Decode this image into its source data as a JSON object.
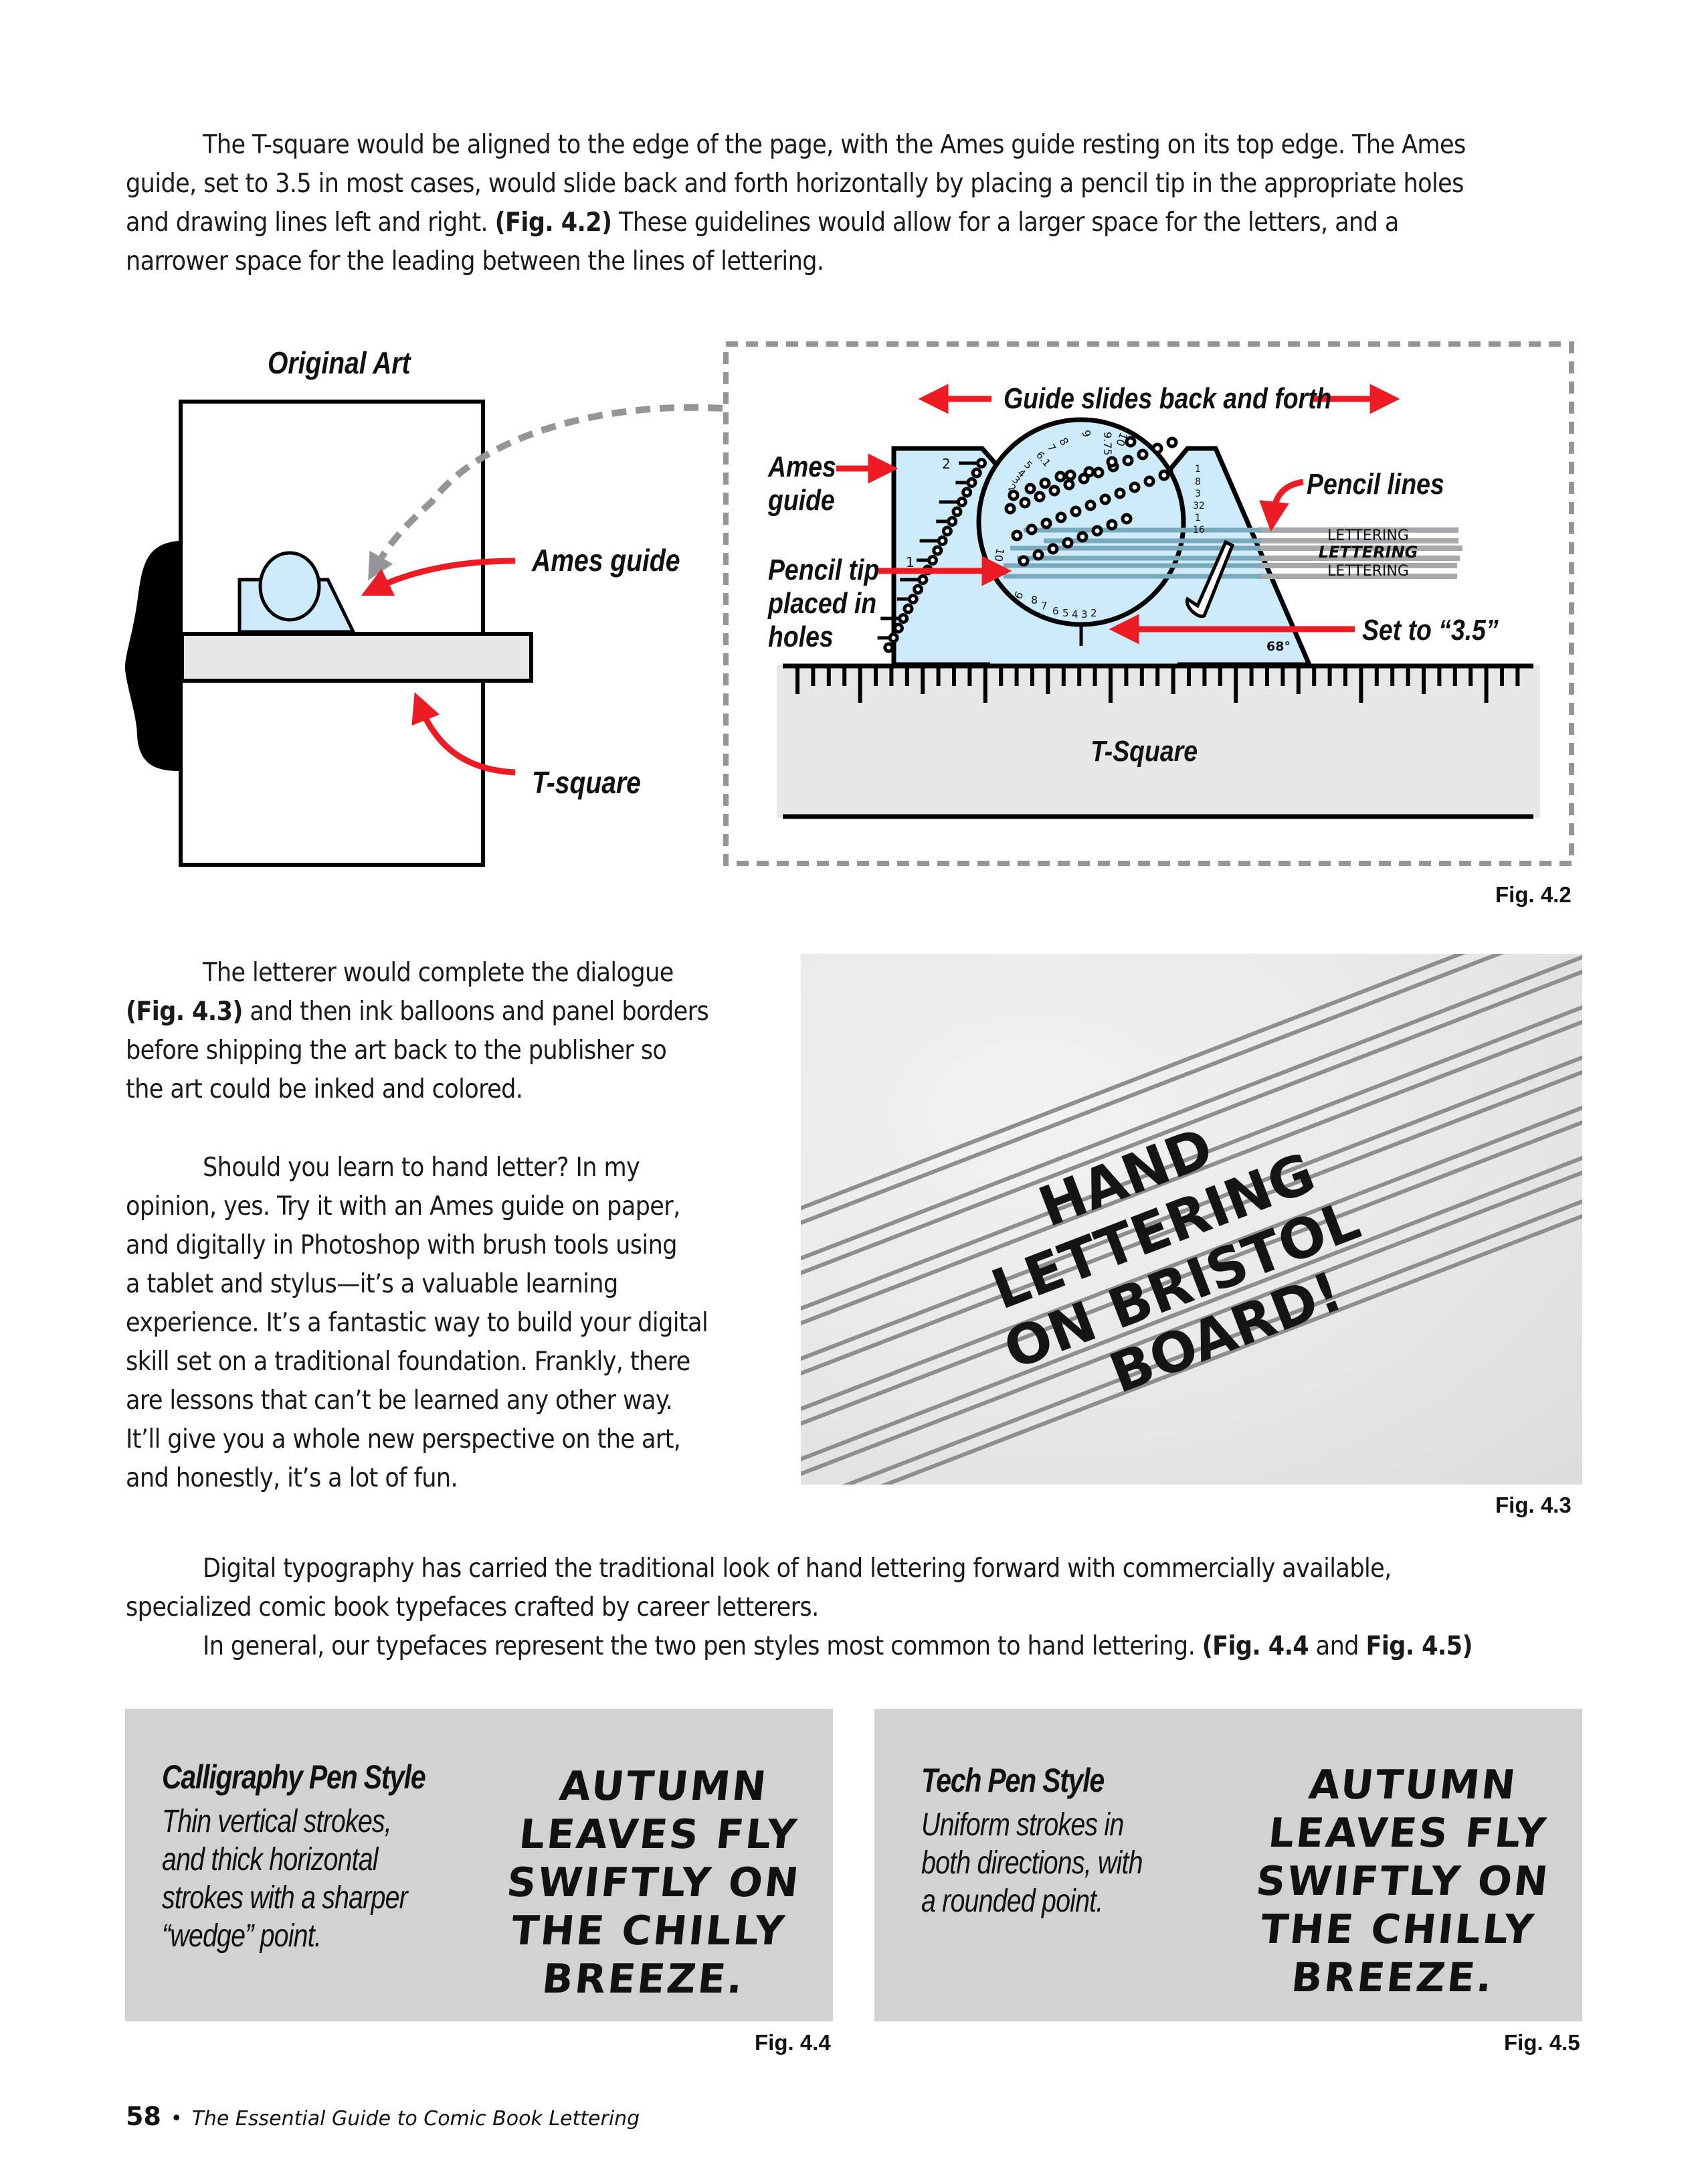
{
  "paragraphs": {
    "intro": {
      "lines": [
        "The T-square would be aligned to the edge of the page, with the Ames guide resting on its top edge. The Ames",
        "guide, set to 3.5 in most cases, would slide back and forth horizontally by placing a pencil tip in the appropriate holes"
      ],
      "line3_pre": "and drawing lines left and right. ",
      "line3_ref": "(Fig. 4.2)",
      "line3_post": " These guidelines would allow for a larger space for the letters, and a",
      "line4": "narrower space for the leading between the lines of lettering."
    },
    "letterer": {
      "line1": "The letterer would complete the dialogue",
      "line2_ref": "(Fig. 4.3)",
      "line2_post": " and then ink balloons and panel borders",
      "line3": "before shipping the art back to the publisher so",
      "line4": "the art could be inked and colored."
    },
    "should": {
      "lines": [
        "Should you learn to hand letter? In my",
        "opinion, yes. Try it with an Ames guide on paper,",
        "and digitally in Photoshop with brush tools using",
        "a tablet and stylus—it’s a valuable learning",
        "experience. It’s a fantastic way to build your digital",
        "skill set on a traditional foundation. Frankly, there",
        "are lessons that can’t be learned any other way.",
        "It’ll give you a whole new perspective on the art,",
        "and honestly, it’s a lot of fun."
      ]
    },
    "digital": {
      "line1": "Digital typography has carried the traditional look of hand lettering forward with commercially available,",
      "line2": "specialized comic book typefaces crafted by career letterers.",
      "line3_pre": "In general, our typefaces represent the two pen styles most common to hand lettering. ",
      "line3_ref1": "(Fig. 4.4",
      "line3_and": " and ",
      "line3_ref2": "Fig. 4.5)"
    }
  },
  "fig42": {
    "caption": "Fig. 4.2",
    "left": {
      "title": "Original Art",
      "ames_label": "Ames guide",
      "tsquare_label": "T-square"
    },
    "right": {
      "slides_label": "Guide slides back and forth",
      "ames_label_line1": "Ames",
      "ames_label_line2": "guide",
      "pencil_tip_line1": "Pencil tip",
      "pencil_tip_line2": "placed in",
      "pencil_tip_line3": "holes",
      "pencil_lines_label": "Pencil lines",
      "set_to_label": "Set to “3.5”",
      "tsquare_label": "T-Square",
      "angle_label": "68°",
      "lettering_samples": [
        "LETTERING",
        "LETTERING",
        "LETTERING"
      ],
      "left_scale_labels": [
        "2",
        "1"
      ],
      "dial_top_labels": [
        "2",
        "3",
        "4",
        "5",
        "6.1",
        "7",
        "8",
        "9",
        "9.75",
        "10"
      ],
      "dial_bottom_labels": [
        "10",
        "9",
        "8",
        "7",
        "6",
        "5",
        "4",
        "3",
        "2"
      ],
      "fraction_labels": [
        {
          "num": "1",
          "den": "8"
        },
        {
          "num": "3",
          "den": "32"
        },
        {
          "num": "1",
          "den": "16"
        }
      ]
    }
  },
  "fig43": {
    "caption": "Fig. 4.3",
    "photo_text": [
      "HAND",
      "LETTERING",
      "ON BRISTOL",
      "BOARD!"
    ]
  },
  "fig44": {
    "caption": "Fig. 4.4",
    "title": "Calligraphy Pen Style",
    "description": [
      "Thin vertical strokes,",
      "and thick horizontal",
      "strokes with a sharper",
      "“wedge” point."
    ],
    "sample": [
      "AUTUMN",
      "LEAVES FLY",
      "SWIFTLY ON",
      "THE CHILLY",
      "BREEZE."
    ]
  },
  "fig45": {
    "caption": "Fig. 4.5",
    "title": "Tech Pen Style",
    "description": [
      "Uniform strokes in",
      "both directions, with",
      "a rounded point."
    ],
    "sample": [
      "AUTUMN",
      "LEAVES FLY",
      "SWIFTLY ON",
      "THE CHILLY",
      "BREEZE."
    ]
  },
  "footer": {
    "page_number": "58",
    "separator": "•",
    "book_title": "The Essential Guide to Comic Book Lettering"
  },
  "colors": {
    "accent_red": "#ed1c24",
    "guide_blue": "#cdebfa",
    "tsquare_grey": "#e6e7e8",
    "dashed_grey": "#939598",
    "panel_grey": "#d1d2d4",
    "pencil_line_grey": "#a7a9ac",
    "guide_line_teal": "#79a9ba"
  }
}
